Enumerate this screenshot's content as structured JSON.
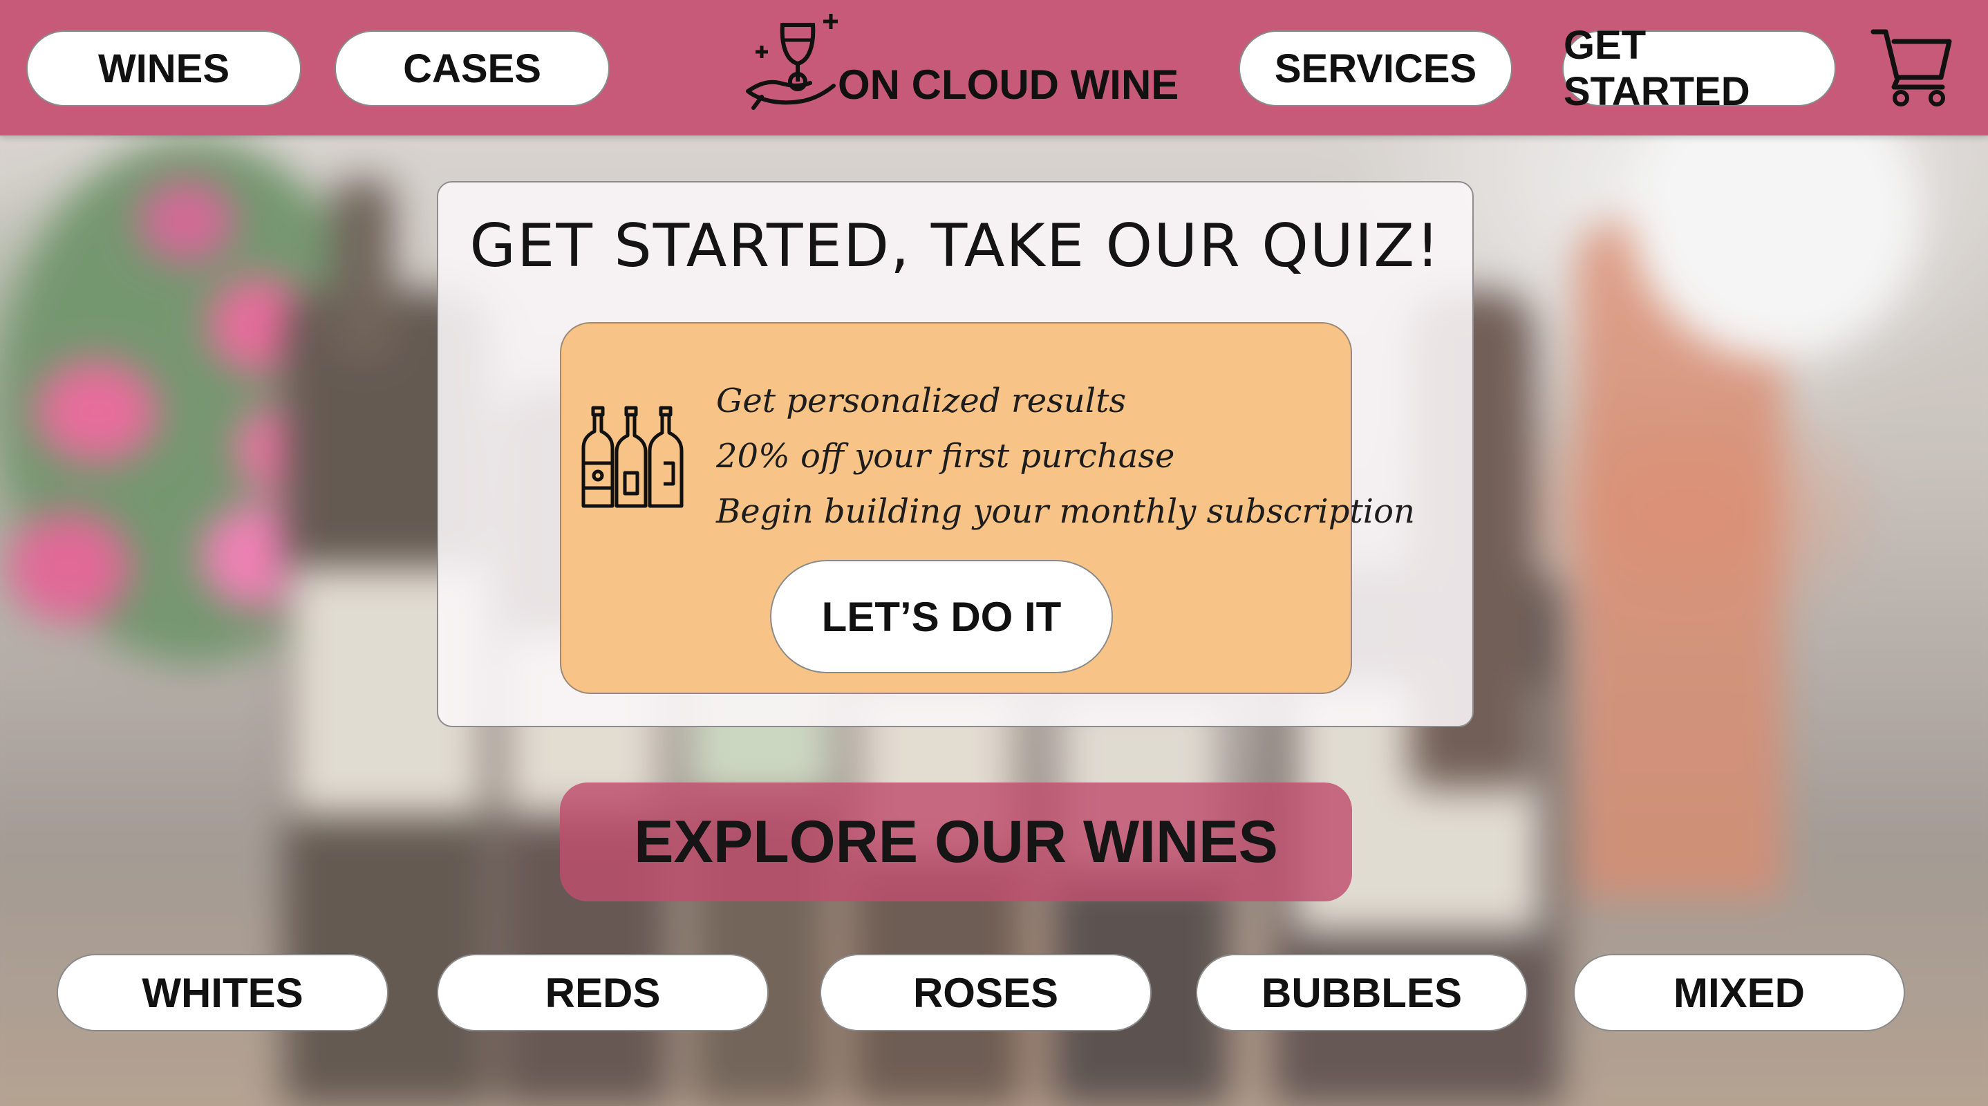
{
  "header": {
    "nav_left": [
      {
        "label": "WINES"
      },
      {
        "label": "CASES"
      }
    ],
    "nav_right": [
      {
        "label": "SERVICES"
      },
      {
        "label": "GET STARTED"
      }
    ],
    "logo_text": "ON CLOUD WINE",
    "logo_icon": "wine-glass-hand-icon",
    "cart_icon": "shopping-cart-icon"
  },
  "quiz": {
    "title": "GET STARTED, TAKE OUR QUIZ!",
    "icon": "wine-bottles-icon",
    "benefits": [
      "Get personalized results",
      "20% off your first purchase",
      "Begin building your monthly subscription"
    ],
    "cta_label": "LET’S DO IT"
  },
  "explore": {
    "label": "EXPLORE OUR WINES"
  },
  "categories": [
    {
      "label": "WHITES"
    },
    {
      "label": "REDS"
    },
    {
      "label": "ROSES"
    },
    {
      "label": "BUBBLES"
    },
    {
      "label": "MIXED"
    }
  ],
  "colors": {
    "header": "#c85a79",
    "promo_bg": "#f8c386",
    "explore_bg": "#c04e6e"
  }
}
